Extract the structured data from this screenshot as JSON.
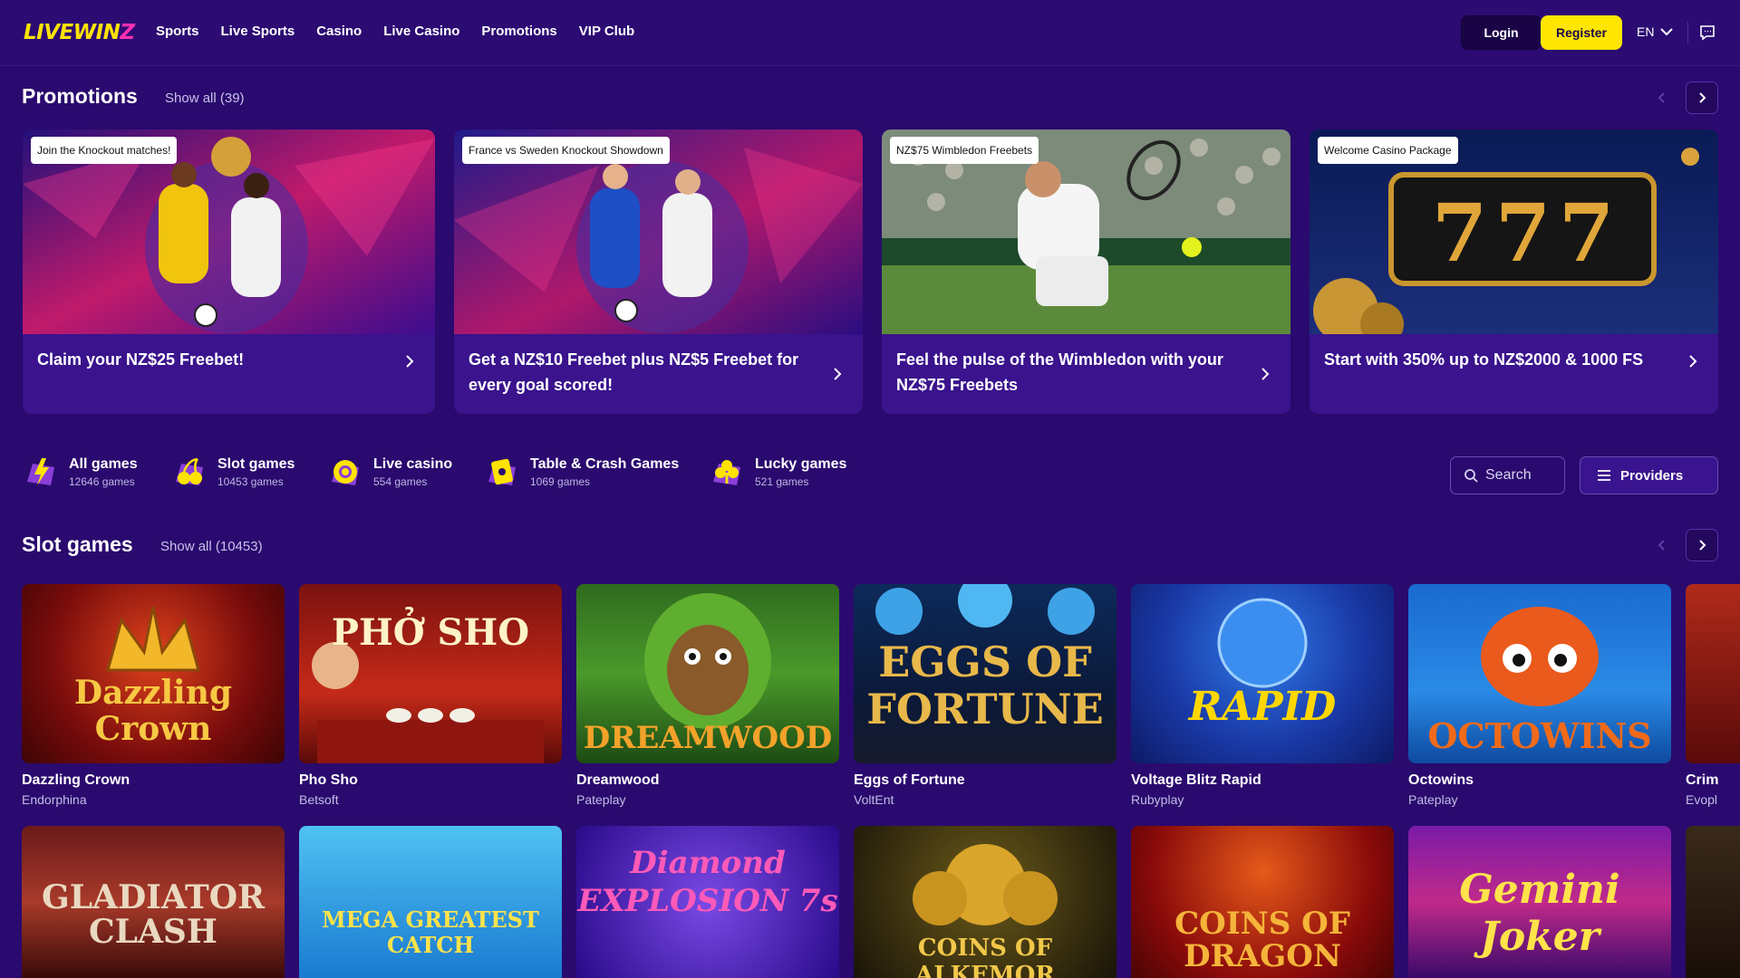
{
  "brand": {
    "logo_text": "LIVEWIN",
    "logo_accent": "Z",
    "accent_color": "#ffe600",
    "bg_color": "#2a0a6e"
  },
  "nav": {
    "items": [
      "Sports",
      "Live Sports",
      "Casino",
      "Live Casino",
      "Promotions",
      "VIP Club"
    ]
  },
  "header": {
    "login_label": "Login",
    "register_label": "Register",
    "language": "EN"
  },
  "promotions": {
    "title": "Promotions",
    "show_all": "Show all (39)",
    "cards": [
      {
        "tag": "Join the Knockout matches!",
        "text": "Claim your NZ$25 Freebet!"
      },
      {
        "tag": "France vs Sweden Knockout Showdown",
        "text": "Get a NZ$10 Freebet plus NZ$5 Freebet for every goal scored!"
      },
      {
        "tag": "NZ$75 Wimbledon Freebets",
        "text": "Feel the pulse of the Wimbledon with your NZ$75 Freebets"
      },
      {
        "tag": "Welcome Casino Package",
        "text": "Start with 350% up to NZ$2000 & 1000 FS"
      }
    ]
  },
  "categories": [
    {
      "name": "All games",
      "count": "12646 games",
      "icon": "lightning-icon"
    },
    {
      "name": "Slot games",
      "count": "10453 games",
      "icon": "cherries-icon"
    },
    {
      "name": "Live casino",
      "count": "554 games",
      "icon": "chip-icon"
    },
    {
      "name": "Table & Crash Games",
      "count": "1069 games",
      "icon": "cards-icon"
    },
    {
      "name": "Lucky games",
      "count": "521 games",
      "icon": "clover-icon"
    }
  ],
  "search": {
    "placeholder": "Search"
  },
  "providers_label": "Providers",
  "slots": {
    "title": "Slot games",
    "show_all": "Show all (10453)",
    "row1": [
      {
        "title": "Dazzling Crown",
        "provider": "Endorphina",
        "art": "Dazzling Crown"
      },
      {
        "title": "Pho Sho",
        "provider": "Betsoft",
        "art": "PHỞ SHO"
      },
      {
        "title": "Dreamwood",
        "provider": "Pateplay",
        "art": "DREAMWOOD"
      },
      {
        "title": "Eggs of Fortune",
        "provider": "VoltEnt",
        "art": "EGGS OF FORTUNE"
      },
      {
        "title": "Voltage Blitz Rapid",
        "provider": "Rubyplay",
        "art": "RAPID"
      },
      {
        "title": "Octowins",
        "provider": "Pateplay",
        "art": "OCTOWINS"
      },
      {
        "title": "Crim",
        "provider": "Evopl",
        "art": ""
      }
    ],
    "row2": [
      {
        "art": "GLADIATOR CLASH"
      },
      {
        "art": "MEGA GREATEST CATCH"
      },
      {
        "art": "Diamond EXPLOSION 7s"
      },
      {
        "art": "COINS OF ALKEMOR"
      },
      {
        "art": "COINS OF DRAGON"
      },
      {
        "art": "Gemini Joker"
      },
      {
        "art": ""
      }
    ]
  }
}
